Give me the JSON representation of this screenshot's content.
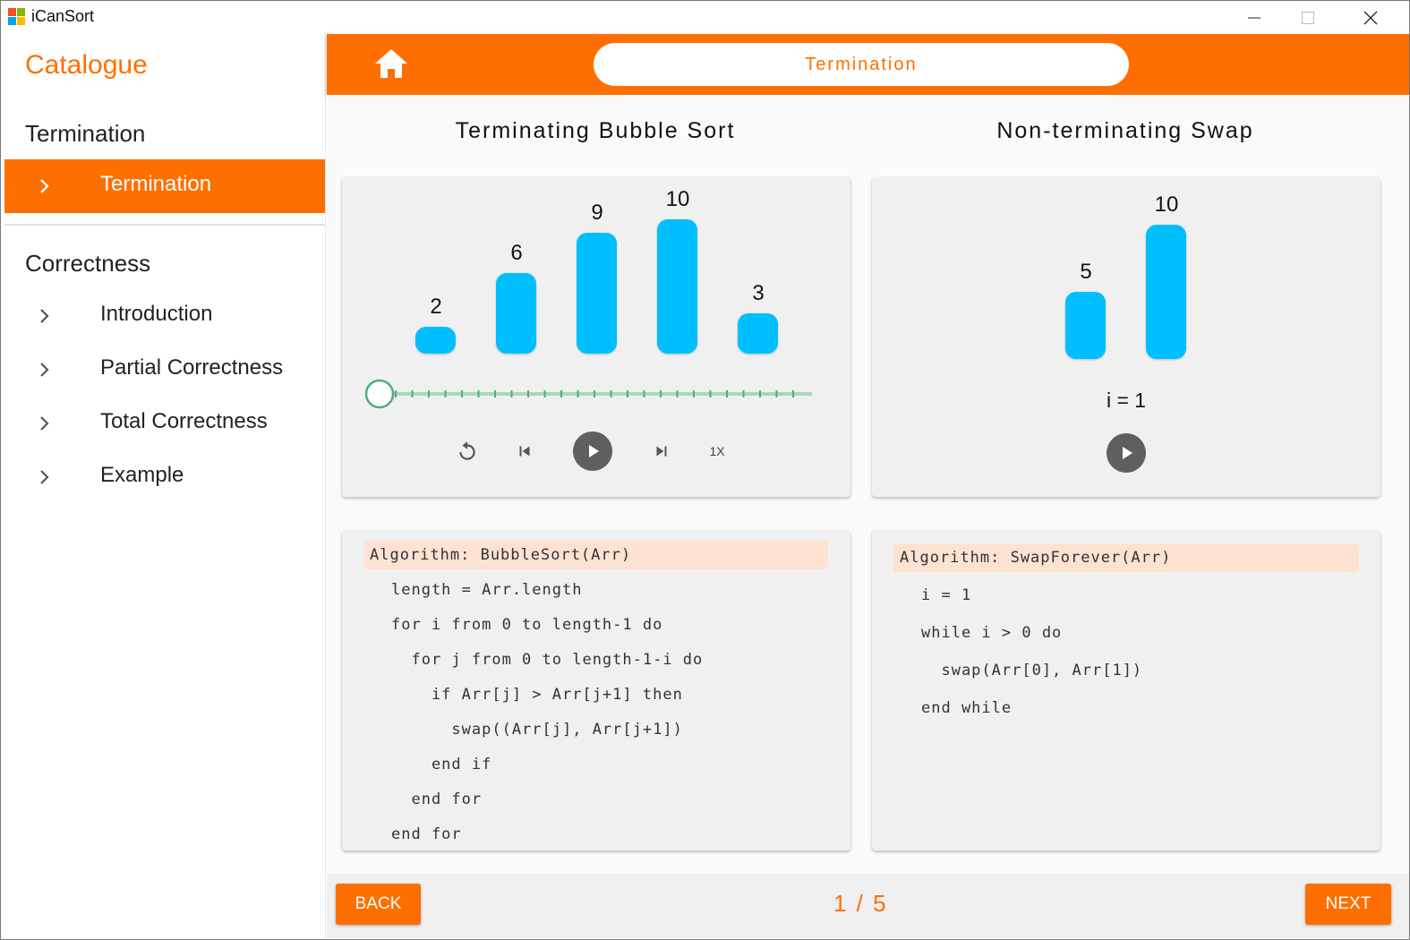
{
  "window": {
    "title": "iCanSort"
  },
  "sidebar": {
    "heading": "Catalogue",
    "sections": [
      {
        "title": "Termination",
        "items": [
          {
            "label": "Termination",
            "active": true
          }
        ]
      },
      {
        "title": "Correctness",
        "items": [
          {
            "label": "Introduction"
          },
          {
            "label": "Partial Correctness"
          },
          {
            "label": "Total Correctness"
          },
          {
            "label": "Example"
          }
        ]
      }
    ]
  },
  "header": {
    "title": "Termination",
    "home_icon": "home-icon"
  },
  "panels": {
    "left": {
      "title": "Terminating Bubble Sort",
      "bars": [
        2,
        6,
        9,
        10,
        3
      ],
      "slider_progress": 0,
      "controls": {
        "speed": "1X"
      },
      "code_header": "Algorithm: BubbleSort(Arr)",
      "code_lines": [
        "length = Arr.length",
        "for i from 0 to length-1 do",
        "  for j from 0 to length-1-i do",
        "    if Arr[j] > Arr[j+1] then",
        "      swap((Arr[j], Arr[j+1])",
        "    end if",
        "  end for",
        "end for"
      ]
    },
    "right": {
      "title": "Non-terminating Swap",
      "bars": [
        5,
        10
      ],
      "status": "i = 1",
      "code_header": "Algorithm: SwapForever(Arr)",
      "code_lines": [
        "i = 1",
        "while i > 0 do",
        "  swap(Arr[0], Arr[1])",
        "end while"
      ]
    }
  },
  "footer": {
    "back_label": "BACK",
    "next_label": "NEXT",
    "page": "1 / 5"
  },
  "colors": {
    "accent": "#ff6f00",
    "bar": "#00bfff",
    "slider": "#4caf7a"
  }
}
